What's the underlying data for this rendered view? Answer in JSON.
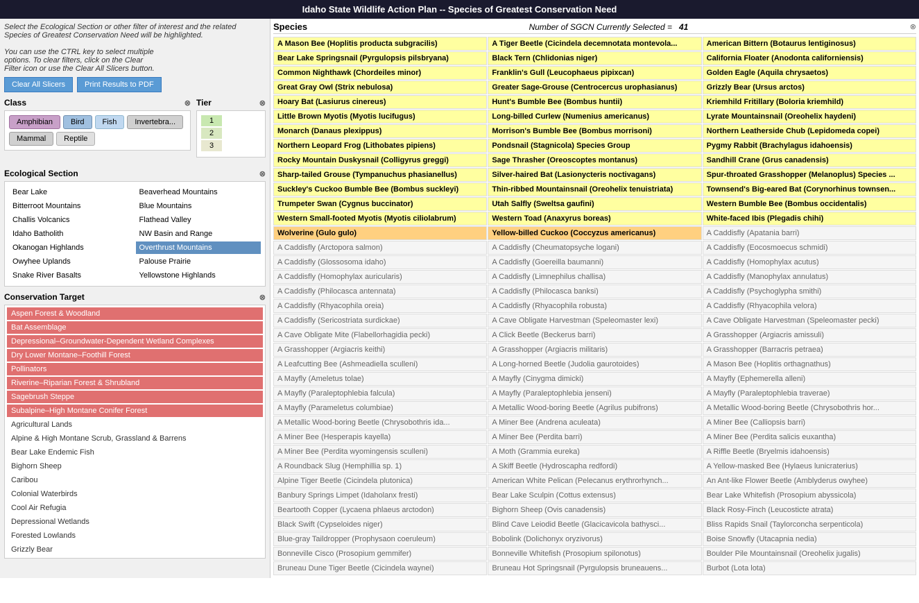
{
  "title": "Idaho State Wildlife Action Plan -- Species of Greatest Conservation Need",
  "instructions": {
    "line1": "Select the Ecological Section or other filter of interest and the related",
    "line2": "Species of Greatest Conservation Need will be highlighted.",
    "line3": "",
    "line4": "You can use the CTRL key to select multiple",
    "line5": "options. To clear filters, click on the Clear",
    "line6": "Filter icon or use the Clear All Slicers button."
  },
  "buttons": {
    "clear_all": "Clear All Slicers",
    "print": "Print Results to PDF"
  },
  "class": {
    "label": "Class",
    "pills": [
      "Amphibian",
      "Bird",
      "Fish",
      "Invertebra...",
      "Mammal",
      "Reptile"
    ]
  },
  "tier": {
    "label": "Tier",
    "items": [
      "1",
      "2",
      "3"
    ]
  },
  "ecological_section": {
    "label": "Ecological Section",
    "items": [
      "Bear Lake",
      "Beaverhead Mountains",
      "Bitterroot Mountains",
      "Blue Mountains",
      "Challis Volcanics",
      "Flathead Valley",
      "Idaho Batholith",
      "NW Basin and Range",
      "Okanogan Highlands",
      "Overthrust Mountains",
      "Owyhee Uplands",
      "Palouse Prairie",
      "Snake River Basalts",
      "Yellowstone Highlands"
    ],
    "selected": "Overthrust Mountains"
  },
  "conservation_target": {
    "label": "Conservation Target",
    "items": [
      {
        "label": "Aspen Forest & Woodland",
        "style": "selected-red"
      },
      {
        "label": "Bat Assemblage",
        "style": "selected-red"
      },
      {
        "label": "Depressional–Groundwater-Dependent Wetland Complexes",
        "style": "selected-red"
      },
      {
        "label": "Dry Lower Montane–Foothill Forest",
        "style": "selected-red"
      },
      {
        "label": "Pollinators",
        "style": "selected-red"
      },
      {
        "label": "Riverine–Riparian Forest & Shrubland",
        "style": "selected-red"
      },
      {
        "label": "Sagebrush Steppe",
        "style": "selected-red"
      },
      {
        "label": "Subalpine–High Montane Conifer Forest",
        "style": "selected-red"
      },
      {
        "label": "Agricultural Lands",
        "style": "plain"
      },
      {
        "label": "Alpine & High Montane Scrub, Grassland & Barrens",
        "style": "plain"
      },
      {
        "label": "Bear Lake Endemic Fish",
        "style": "plain"
      },
      {
        "label": "Bighorn Sheep",
        "style": "plain"
      },
      {
        "label": "Caribou",
        "style": "plain"
      },
      {
        "label": "Colonial Waterbirds",
        "style": "plain"
      },
      {
        "label": "Cool Air Refugia",
        "style": "plain"
      },
      {
        "label": "Depressional Wetlands",
        "style": "plain"
      },
      {
        "label": "Forested Lowlands",
        "style": "plain"
      },
      {
        "label": "Grizzly Bear",
        "style": "plain"
      }
    ]
  },
  "species": {
    "title": "Species",
    "count_label": "Number of SGCN Currently Selected =",
    "count": "41",
    "cells": [
      {
        "text": "A Mason Bee (Hoplitis producta subgracilis)",
        "style": "highlighted"
      },
      {
        "text": "A Tiger Beetle (Cicindela decemnotata montevola...",
        "style": "highlighted"
      },
      {
        "text": "American Bittern (Botaurus lentiginosus)",
        "style": "highlighted"
      },
      {
        "text": "Bear Lake Springsnail (Pyrgulopsis pilsbryana)",
        "style": "highlighted"
      },
      {
        "text": "Black Tern (Chlidonias niger)",
        "style": "highlighted"
      },
      {
        "text": "California Floater (Anodonta californiensis)",
        "style": "highlighted"
      },
      {
        "text": "Common Nighthawk (Chordeiles minor)",
        "style": "highlighted"
      },
      {
        "text": "Franklin's Gull (Leucophaeus pipixcan)",
        "style": "highlighted"
      },
      {
        "text": "Golden Eagle (Aquila chrysaetos)",
        "style": "highlighted"
      },
      {
        "text": "Great Gray Owl (Strix nebulosa)",
        "style": "highlighted"
      },
      {
        "text": "Greater Sage-Grouse (Centrocercus urophasianus)",
        "style": "highlighted"
      },
      {
        "text": "Grizzly Bear (Ursus arctos)",
        "style": "highlighted"
      },
      {
        "text": "Hoary Bat (Lasiurus cinereus)",
        "style": "highlighted"
      },
      {
        "text": "Hunt's Bumble Bee (Bombus huntii)",
        "style": "highlighted"
      },
      {
        "text": "Kriemhild Fritillary (Boloria kriemhild)",
        "style": "highlighted"
      },
      {
        "text": "Little Brown Myotis (Myotis lucifugus)",
        "style": "highlighted"
      },
      {
        "text": "Long-billed Curlew (Numenius americanus)",
        "style": "highlighted"
      },
      {
        "text": "Lyrate Mountainsnail (Oreohelix haydeni)",
        "style": "highlighted"
      },
      {
        "text": "Monarch (Danaus plexippus)",
        "style": "highlighted"
      },
      {
        "text": "Morrison's Bumble Bee (Bombus morrisoni)",
        "style": "highlighted"
      },
      {
        "text": "Northern Leatherside Chub (Lepidomeda copei)",
        "style": "highlighted"
      },
      {
        "text": "Northern Leopard Frog (Lithobates pipiens)",
        "style": "highlighted"
      },
      {
        "text": "Pondsnail (Stagnicola) Species Group",
        "style": "highlighted"
      },
      {
        "text": "Pygmy Rabbit (Brachylagus idahoensis)",
        "style": "highlighted"
      },
      {
        "text": "Rocky Mountain Duskysnail (Colligyrus greggi)",
        "style": "highlighted"
      },
      {
        "text": "Sage Thrasher (Oreoscoptes montanus)",
        "style": "highlighted"
      },
      {
        "text": "Sandhill Crane (Grus canadensis)",
        "style": "highlighted"
      },
      {
        "text": "Sharp-tailed Grouse (Tympanuchus phasianellus)",
        "style": "highlighted"
      },
      {
        "text": "Silver-haired Bat (Lasionycteris noctivagans)",
        "style": "highlighted"
      },
      {
        "text": "Spur-throated Grasshopper (Melanoplus) Species ...",
        "style": "highlighted"
      },
      {
        "text": "Suckley's Cuckoo Bumble Bee (Bombus suckleyi)",
        "style": "highlighted"
      },
      {
        "text": "Thin-ribbed Mountainsnail (Oreohelix tenuistriata)",
        "style": "highlighted"
      },
      {
        "text": "Townsend's Big-eared Bat (Corynorhinus townsen...",
        "style": "highlighted"
      },
      {
        "text": "Trumpeter Swan (Cygnus buccinator)",
        "style": "highlighted"
      },
      {
        "text": "Utah Salfly (Sweltsa gaufini)",
        "style": "highlighted"
      },
      {
        "text": "Western Bumble Bee (Bombus occidentalis)",
        "style": "highlighted"
      },
      {
        "text": "Western Small-footed Myotis (Myotis ciliolabrum)",
        "style": "highlighted"
      },
      {
        "text": "Western Toad (Anaxyrus boreas)",
        "style": "highlighted"
      },
      {
        "text": "White-faced Ibis (Plegadis chihi)",
        "style": "highlighted"
      },
      {
        "text": "Wolverine (Gulo gulo)",
        "style": "bold-orange"
      },
      {
        "text": "Yellow-billed Cuckoo (Coccyzus americanus)",
        "style": "bold-orange"
      },
      {
        "text": "A Caddisfly (Apatania barri)",
        "style": "gray"
      },
      {
        "text": "A Caddisfly (Arctopora salmon)",
        "style": "gray"
      },
      {
        "text": "A Caddisfly (Cheumatopsyche logani)",
        "style": "gray"
      },
      {
        "text": "A Caddisfly (Eocosmoecus schmidi)",
        "style": "gray"
      },
      {
        "text": "A Caddisfly (Glossosoma idaho)",
        "style": "gray"
      },
      {
        "text": "A Caddisfly (Goereilla baumanni)",
        "style": "gray"
      },
      {
        "text": "A Caddisfly (Homophylax acutus)",
        "style": "gray"
      },
      {
        "text": "A Caddisfly (Homophylax auricularis)",
        "style": "gray"
      },
      {
        "text": "A Caddisfly (Limnephilus challisa)",
        "style": "gray"
      },
      {
        "text": "A Caddisfly (Manophylax annulatus)",
        "style": "gray"
      },
      {
        "text": "A Caddisfly (Philocasca antennata)",
        "style": "gray"
      },
      {
        "text": "A Caddisfly (Philocasca banksi)",
        "style": "gray"
      },
      {
        "text": "A Caddisfly (Psychoglypha smithi)",
        "style": "gray"
      },
      {
        "text": "A Caddisfly (Rhyacophila oreia)",
        "style": "gray"
      },
      {
        "text": "A Caddisfly (Rhyacophila robusta)",
        "style": "gray"
      },
      {
        "text": "A Caddisfly (Rhyacophila velora)",
        "style": "gray"
      },
      {
        "text": "A Caddisfly (Sericostriata surdickae)",
        "style": "gray"
      },
      {
        "text": "A Cave Obligate Harvestman (Speleomaster lexi)",
        "style": "gray"
      },
      {
        "text": "A Cave Obligate Harvestman (Speleomaster pecki)",
        "style": "gray"
      },
      {
        "text": "A Cave Obligate Mite (Flabellorhagidia pecki)",
        "style": "gray"
      },
      {
        "text": "A Click Beetle (Beckerus barri)",
        "style": "gray"
      },
      {
        "text": "A Grasshopper (Argiacris amissuli)",
        "style": "gray"
      },
      {
        "text": "A Grasshopper (Argiacris keithi)",
        "style": "gray"
      },
      {
        "text": "A Grasshopper (Argiacris militaris)",
        "style": "gray"
      },
      {
        "text": "A Grasshopper (Barracris petraea)",
        "style": "gray"
      },
      {
        "text": "A Leafcutting Bee (Ashmeadiella sculleni)",
        "style": "gray"
      },
      {
        "text": "A Long-horned Beetle (Judolia gaurotoides)",
        "style": "gray"
      },
      {
        "text": "A Mason Bee (Hoplitis orthagnathus)",
        "style": "gray"
      },
      {
        "text": "A Mayfly (Ameletus tolae)",
        "style": "gray"
      },
      {
        "text": "A Mayfly (Cinygma dimicki)",
        "style": "gray"
      },
      {
        "text": "A Mayfly (Ephemerella alleni)",
        "style": "gray"
      },
      {
        "text": "A Mayfly (Paraleptophlebia falcula)",
        "style": "gray"
      },
      {
        "text": "A Mayfly (Paraleptophlebia jenseni)",
        "style": "gray"
      },
      {
        "text": "A Mayfly (Paraleptophlebia traverae)",
        "style": "gray"
      },
      {
        "text": "A Mayfly (Parameletus columbiae)",
        "style": "gray"
      },
      {
        "text": "A Metallic Wood-boring Beetle (Agrilus pubifrons)",
        "style": "gray"
      },
      {
        "text": "A Metallic Wood-boring Beetle (Chrysobothris hor...",
        "style": "gray"
      },
      {
        "text": "A Metallic Wood-boring Beetle (Chrysobothris ida...",
        "style": "gray"
      },
      {
        "text": "A Miner Bee (Andrena aculeata)",
        "style": "gray"
      },
      {
        "text": "A Miner Bee (Calliopsis barri)",
        "style": "gray"
      },
      {
        "text": "A Miner Bee (Hesperapis kayella)",
        "style": "gray"
      },
      {
        "text": "A Miner Bee (Perdita barri)",
        "style": "gray"
      },
      {
        "text": "A Miner Bee (Perdita salicis euxantha)",
        "style": "gray"
      },
      {
        "text": "A Miner Bee (Perdita wyomingensis sculleni)",
        "style": "gray"
      },
      {
        "text": "A Moth (Grammia eureka)",
        "style": "gray"
      },
      {
        "text": "A Riffle Beetle (Bryelmis idahoensis)",
        "style": "gray"
      },
      {
        "text": "A Roundback Slug (Hemphillia sp. 1)",
        "style": "gray"
      },
      {
        "text": "A Skiff Beetle (Hydroscapha redfordi)",
        "style": "gray"
      },
      {
        "text": "A Yellow-masked Bee (Hylaeus lunicraterius)",
        "style": "gray"
      },
      {
        "text": "Alpine Tiger Beetle (Cicindela plutonica)",
        "style": "gray"
      },
      {
        "text": "American White Pelican (Pelecanus erythrorhynch...",
        "style": "gray"
      },
      {
        "text": "An Ant-like Flower Beetle (Amblyderus owyhee)",
        "style": "gray"
      },
      {
        "text": "Banbury Springs Limpet (Idaholanx fresti)",
        "style": "gray"
      },
      {
        "text": "Bear Lake Sculpin (Cottus extensus)",
        "style": "gray"
      },
      {
        "text": "Bear Lake Whitefish (Prosopium abyssicola)",
        "style": "gray"
      },
      {
        "text": "Beartooth Copper (Lycaena phlaeus arctodon)",
        "style": "gray"
      },
      {
        "text": "Bighorn Sheep (Ovis canadensis)",
        "style": "gray"
      },
      {
        "text": "Black Rosy-Finch (Leucosticte atrata)",
        "style": "gray"
      },
      {
        "text": "Black Swift (Cypseloides niger)",
        "style": "gray"
      },
      {
        "text": "Blind Cave Leiodid Beetle (Glacicavicola bathysci...",
        "style": "gray"
      },
      {
        "text": "Bliss Rapids Snail (Taylorconcha serpenticola)",
        "style": "gray"
      },
      {
        "text": "Blue-gray Taildropper (Prophysaon coeruleum)",
        "style": "gray"
      },
      {
        "text": "Bobolink (Dolichonyx oryzivorus)",
        "style": "gray"
      },
      {
        "text": "Boise Snowfly (Utacapnia nedia)",
        "style": "gray"
      },
      {
        "text": "Bonneville Cisco (Prosopium gemmifer)",
        "style": "gray"
      },
      {
        "text": "Bonneville Whitefish (Prosopium spilonotus)",
        "style": "gray"
      },
      {
        "text": "Boulder Pile Mountainsnail (Oreohelix jugalis)",
        "style": "gray"
      },
      {
        "text": "Bruneau Dune Tiger Beetle (Cicindela waynei)",
        "style": "gray"
      },
      {
        "text": "Bruneau Hot Springsnail (Pyrgulopsis bruneauens...",
        "style": "gray"
      },
      {
        "text": "Burbot (Lota lota)",
        "style": "gray"
      }
    ]
  }
}
